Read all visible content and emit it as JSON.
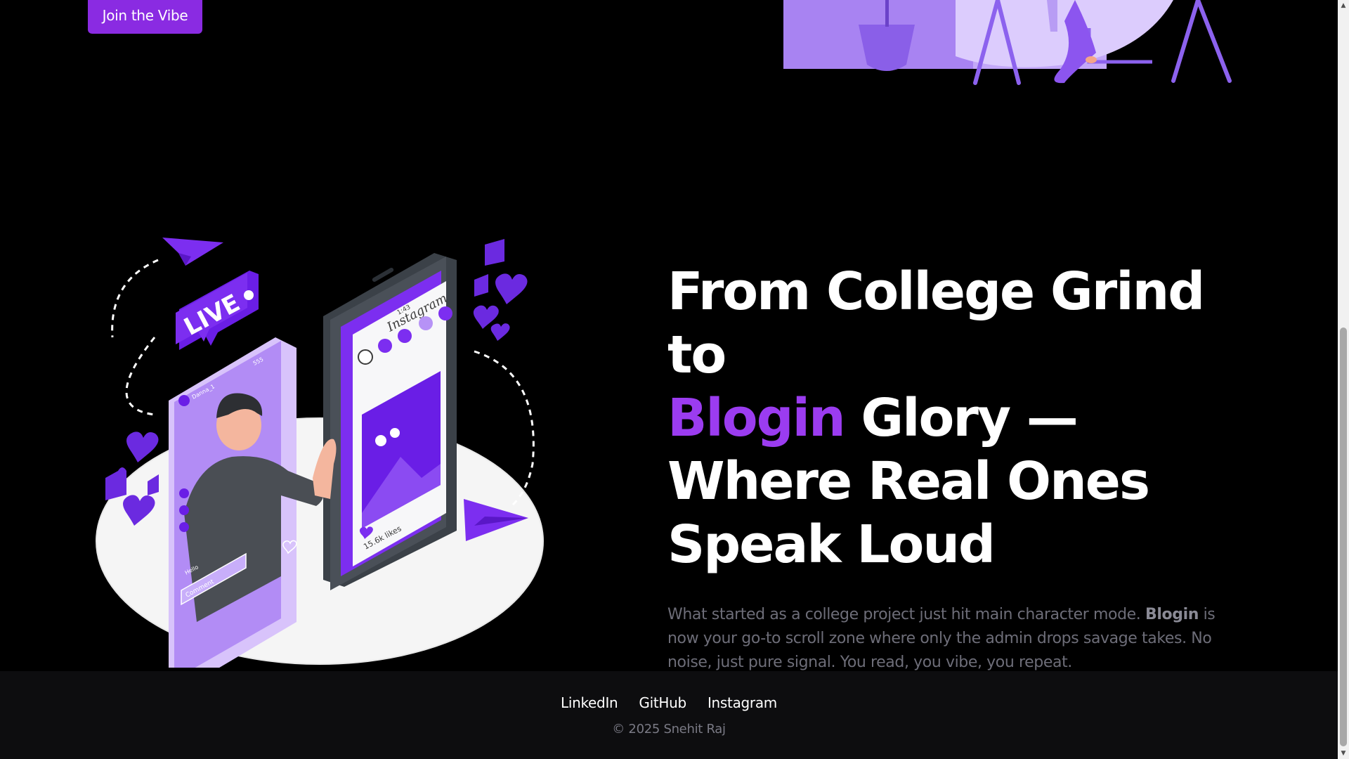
{
  "cta": {
    "label": "Join the Vibe"
  },
  "hero": {
    "title_part1": "From College Grind to",
    "title_accent": "Blogin",
    "title_part2": " Glory —",
    "title_part3": "Where Real Ones",
    "title_part4": "Speak Loud",
    "desc_part1": "What started as a college project just hit main character mode. ",
    "desc_brand": "Blogin",
    "desc_part2": " is now your go-to scroll zone where only the admin drops savage takes. No noise, just pure signal. You read, you vibe, you repeat."
  },
  "illustration": {
    "live_badge": "LIVE",
    "phone_app_name": "Instagram",
    "phone_time": "1:43",
    "likes_count": "15.6k likes",
    "live_user": "Danna_1",
    "live_viewers": "555",
    "comment_placeholder": "Comment",
    "hello_bubble": "Hello"
  },
  "footer": {
    "links": [
      "LinkedIn",
      "GitHub",
      "Instagram"
    ],
    "copyright": "© 2025 Snehit Raj"
  },
  "colors": {
    "accent": "#9b3cf0",
    "button": "#8a2be2",
    "background": "#000000",
    "footer_bg": "#0d0d0f"
  },
  "icons": {
    "scroll_up": "scroll-up-arrow-icon",
    "scroll_down": "scroll-down-arrow-icon"
  }
}
